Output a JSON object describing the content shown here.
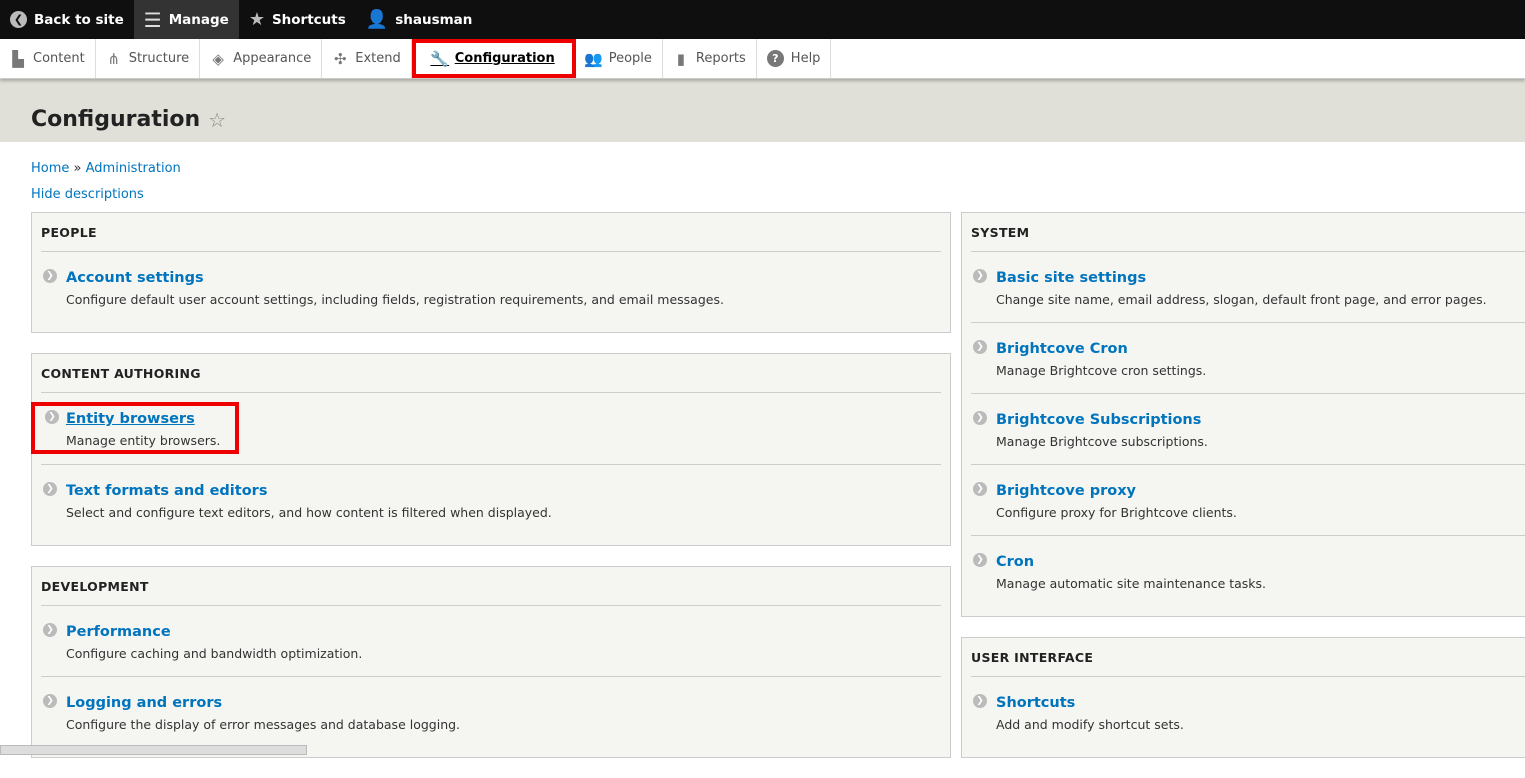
{
  "toolbar": {
    "back": "Back to site",
    "manage": "Manage",
    "shortcuts": "Shortcuts",
    "user": "shausman"
  },
  "tray": [
    {
      "label": "Content",
      "icon": "file-icon"
    },
    {
      "label": "Structure",
      "icon": "sitemap-icon"
    },
    {
      "label": "Appearance",
      "icon": "paintbrush-icon"
    },
    {
      "label": "Extend",
      "icon": "puzzle-icon"
    },
    {
      "label": "Configuration",
      "icon": "wrench-icon"
    },
    {
      "label": "People",
      "icon": "people-icon"
    },
    {
      "label": "Reports",
      "icon": "bar-chart-icon"
    },
    {
      "label": "Help",
      "icon": "help-icon"
    }
  ],
  "page": {
    "title": "Configuration",
    "breadcrumb": [
      "Home",
      "Administration"
    ],
    "sep": "»",
    "hide_descriptions": "Hide descriptions"
  },
  "left": [
    {
      "title": "PEOPLE",
      "items": [
        {
          "label": "Account settings",
          "desc": "Configure default user account settings, including fields, registration requirements, and email messages."
        }
      ]
    },
    {
      "title": "CONTENT AUTHORING",
      "items": [
        {
          "label": "Entity browsers",
          "desc": "Manage entity browsers."
        },
        {
          "label": "Text formats and editors",
          "desc": "Select and configure text editors, and how content is filtered when displayed."
        }
      ]
    },
    {
      "title": "DEVELOPMENT",
      "items": [
        {
          "label": "Performance",
          "desc": "Configure caching and bandwidth optimization."
        },
        {
          "label": "Logging and errors",
          "desc": "Configure the display of error messages and database logging."
        }
      ]
    }
  ],
  "right": [
    {
      "title": "SYSTEM",
      "items": [
        {
          "label": "Basic site settings",
          "desc": "Change site name, email address, slogan, default front page, and error pages."
        },
        {
          "label": "Brightcove Cron",
          "desc": "Manage Brightcove cron settings."
        },
        {
          "label": "Brightcove Subscriptions",
          "desc": "Manage Brightcove subscriptions."
        },
        {
          "label": "Brightcove proxy",
          "desc": "Configure proxy for Brightcove clients."
        },
        {
          "label": "Cron",
          "desc": "Manage automatic site maintenance tasks."
        }
      ]
    },
    {
      "title": "USER INTERFACE",
      "items": [
        {
          "label": "Shortcuts",
          "desc": "Add and modify shortcut sets."
        }
      ]
    }
  ]
}
